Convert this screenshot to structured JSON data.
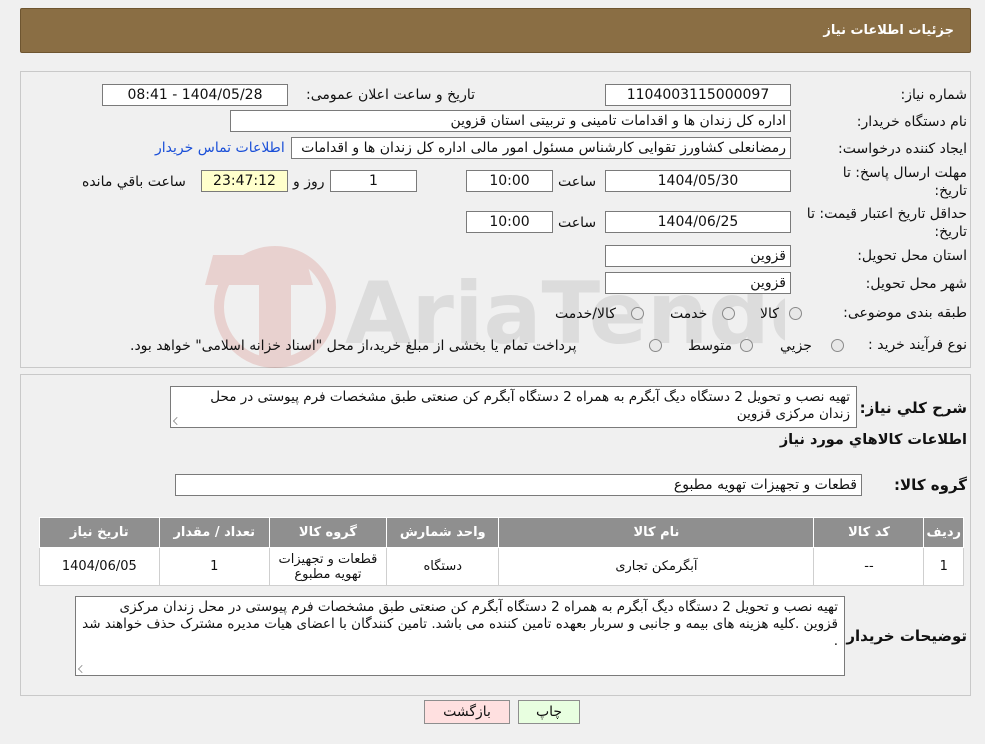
{
  "header": {
    "title": "جزئیات اطلاعات نیاز"
  },
  "form": {
    "need_number_label": "شماره نیاز:",
    "need_number": "1104003115000097",
    "announce_label": "تاریخ و ساعت اعلان عمومی:",
    "announce_value": "1404/05/28 - 08:41",
    "buyer_label": "نام دستگاه خریدار:",
    "buyer_value": "اداره کل زندان ها و اقدامات تامینی و تربیتی استان قزوین",
    "creator_label": "ایجاد کننده درخواست:",
    "creator_value": "رمضانعلی کشاورز تقوایی کارشناس مسئول امور مالی  اداره کل زندان ها و اقدامات",
    "contact_link": "اطلاعات تماس خریدار",
    "deadline_label_1": "مهلت ارسال پاسخ: تا",
    "deadline_label_2": "تاریخ:",
    "deadline_date": "1404/05/30",
    "time_label": "ساعت",
    "deadline_time": "10:00",
    "days_value": "1",
    "days_label": "روز و",
    "remaining_value": "23:47:12",
    "remaining_label": "ساعت باقي مانده",
    "validity_label_1": "حداقل تاریخ اعتبار قیمت: تا",
    "validity_label_2": "تاریخ:",
    "validity_date": "1404/06/25",
    "validity_time": "10:00",
    "province_label": "استان محل تحویل:",
    "province_value": "قزوین",
    "city_label": "شهر محل تحویل:",
    "city_value": "قزوین",
    "category_label": "طبقه بندی موضوعی:",
    "category_options": [
      "کالا",
      "خدمت",
      "کالا/خدمت"
    ],
    "purchase_label": "نوع فرآیند خرید :",
    "purchase_options": [
      "جزیي",
      "متوسط"
    ],
    "purchase_note": "پرداخت تمام یا بخشی از مبلغ خرید،از محل \"اسناد خزانه اسلامی\" خواهد بود."
  },
  "details": {
    "summary_label": "شرح کلي نياز:",
    "summary_text": "تهیه نصب و تحویل 2 دستگاه دیگ آبگرم به همراه 2 دستگاه آبگرم کن صنعتی طبق مشخصات فرم پیوستی در محل زندان مرکزی قزوین",
    "goods_info_title": "اطلاعات کالاهاي مورد نياز",
    "goods_group_label": "گروه کالا:",
    "goods_group_value": "قطعات و تجهیزات تهویه مطبوع",
    "table": {
      "headers": [
        "رديف",
        "کد کالا",
        "نام کالا",
        "واحد شمارش",
        "گروه کالا",
        "تعداد / مقدار",
        "تاريخ نياز"
      ],
      "rows": [
        [
          "1",
          "--",
          "آبگرمکن تجاری",
          "دستگاه",
          "قطعات و تجهیزات تهویه مطبوع",
          "1",
          "1404/06/05"
        ]
      ]
    },
    "buyer_notes_label": "توضيحات خريدار:",
    "buyer_notes_text": "تهیه نصب و تحویل 2 دستگاه دیگ آبگرم به همراه 2 دستگاه آبگرم کن صنعتی طبق مشخصات فرم پیوستی در محل زندان مرکزی قزوین  .کلیه هزینه های بیمه و جانبی و سربار بعهده تامین کننده می باشد. تامین کنندگان با اعضای هیات مدیره مشترک حذف خواهند شد ."
  },
  "buttons": {
    "print": "چاپ",
    "back": "بازگشت"
  },
  "colors": {
    "header": "#8a6e44",
    "link": "#1a4fd8",
    "back_button": "#ffe0e0",
    "print_button": "#e8ffe0",
    "remaining_box": "#ffffcc"
  }
}
